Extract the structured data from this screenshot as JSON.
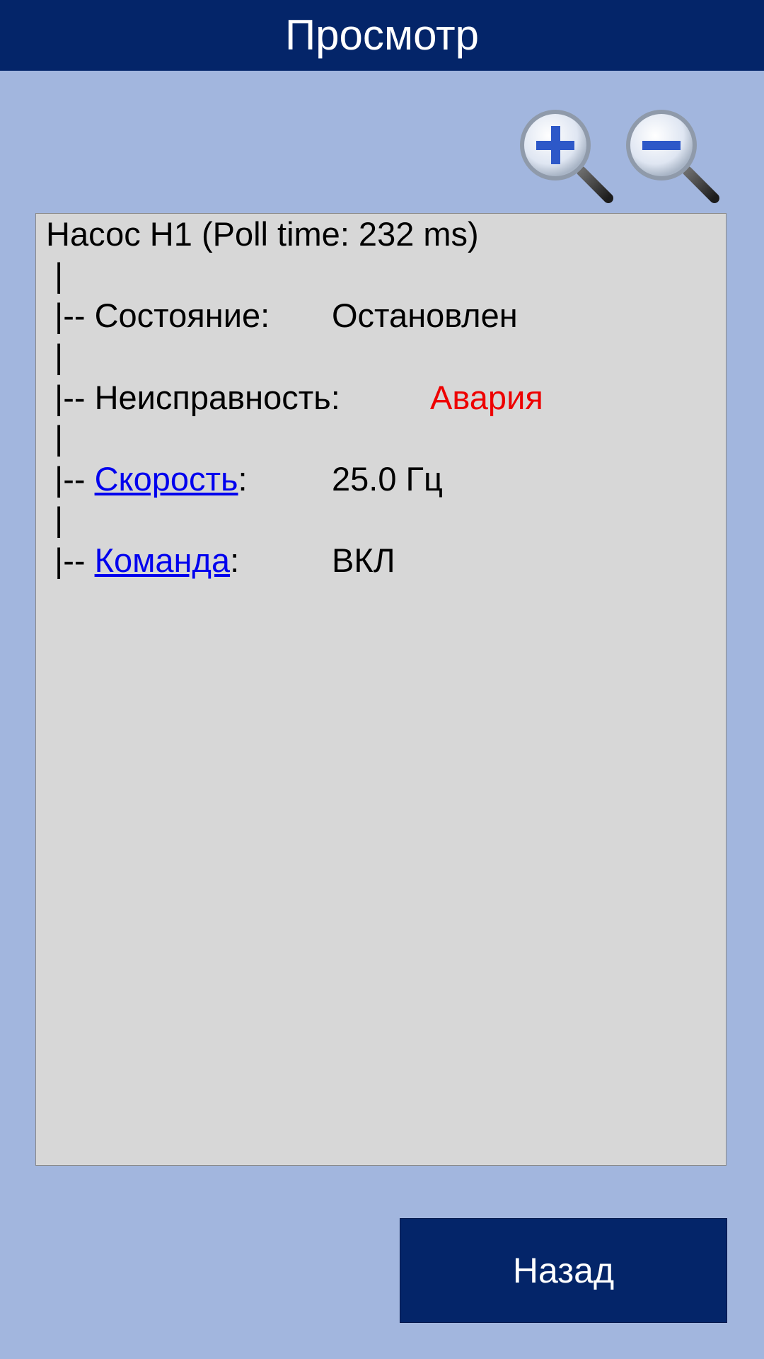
{
  "header": {
    "title": "Просмотр"
  },
  "toolbar": {
    "zoom_in_icon": "zoom-in-magnifier-icon",
    "zoom_out_icon": "zoom-out-magnifier-icon"
  },
  "device": {
    "title": "Насос Н1 (Poll time: 232 ms)",
    "branch_pipe": "|",
    "branch_prefix": "|-- ",
    "rows": [
      {
        "label": "Состояние",
        "colon": ":",
        "value": "Остановлен",
        "is_link": false,
        "value_color": "#000000"
      },
      {
        "label": "Неисправность",
        "colon": ":",
        "value": "Авария",
        "is_link": false,
        "value_color": "#ee0000"
      },
      {
        "label": "Скорость",
        "colon": ":",
        "value": "25.0 Гц",
        "is_link": true,
        "value_color": "#000000"
      },
      {
        "label": "Команда",
        "colon": ":",
        "value": "ВКЛ",
        "is_link": true,
        "value_color": "#000000"
      }
    ]
  },
  "footer": {
    "back_label": "Назад"
  },
  "colors": {
    "header_bg": "#042569",
    "page_bg": "#a2b6de",
    "panel_bg": "#d7d7d7",
    "link": "#0000ee",
    "alarm": "#ee0000"
  }
}
